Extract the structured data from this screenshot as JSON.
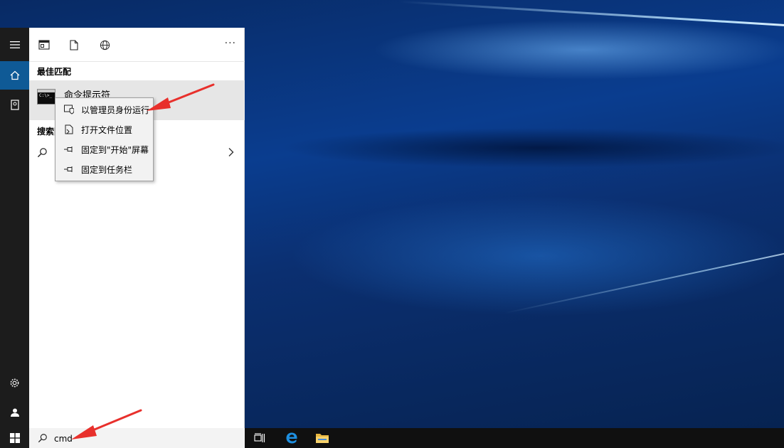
{
  "start_panel": {
    "scope_tabs": [
      {
        "name": "apps-scope-icon"
      },
      {
        "name": "documents-scope-icon"
      },
      {
        "name": "web-scope-icon"
      }
    ],
    "more_label": "···",
    "best_match_title": "最佳匹配",
    "best_match_item": "命令提示符",
    "search_web_title": "搜索网",
    "context_menu": [
      {
        "icon": "run-as-admin-icon",
        "label": "以管理员身份运行"
      },
      {
        "icon": "open-file-location-icon",
        "label": "打开文件位置"
      },
      {
        "icon": "pin-icon",
        "label": "固定到\"开始\"屏幕"
      },
      {
        "icon": "pin-icon",
        "label": "固定到任务栏"
      }
    ]
  },
  "left_rail": {
    "items": [
      "hamburger-menu-icon",
      "home-icon",
      "collection-icon",
      "settings-icon",
      "account-icon"
    ]
  },
  "taskbar": {
    "search_value": "cmd",
    "apps": [
      "task-view-icon",
      "edge-icon",
      "file-explorer-icon"
    ]
  },
  "colors": {
    "accent": "#0f5a96",
    "annotation": "#e8302c"
  }
}
